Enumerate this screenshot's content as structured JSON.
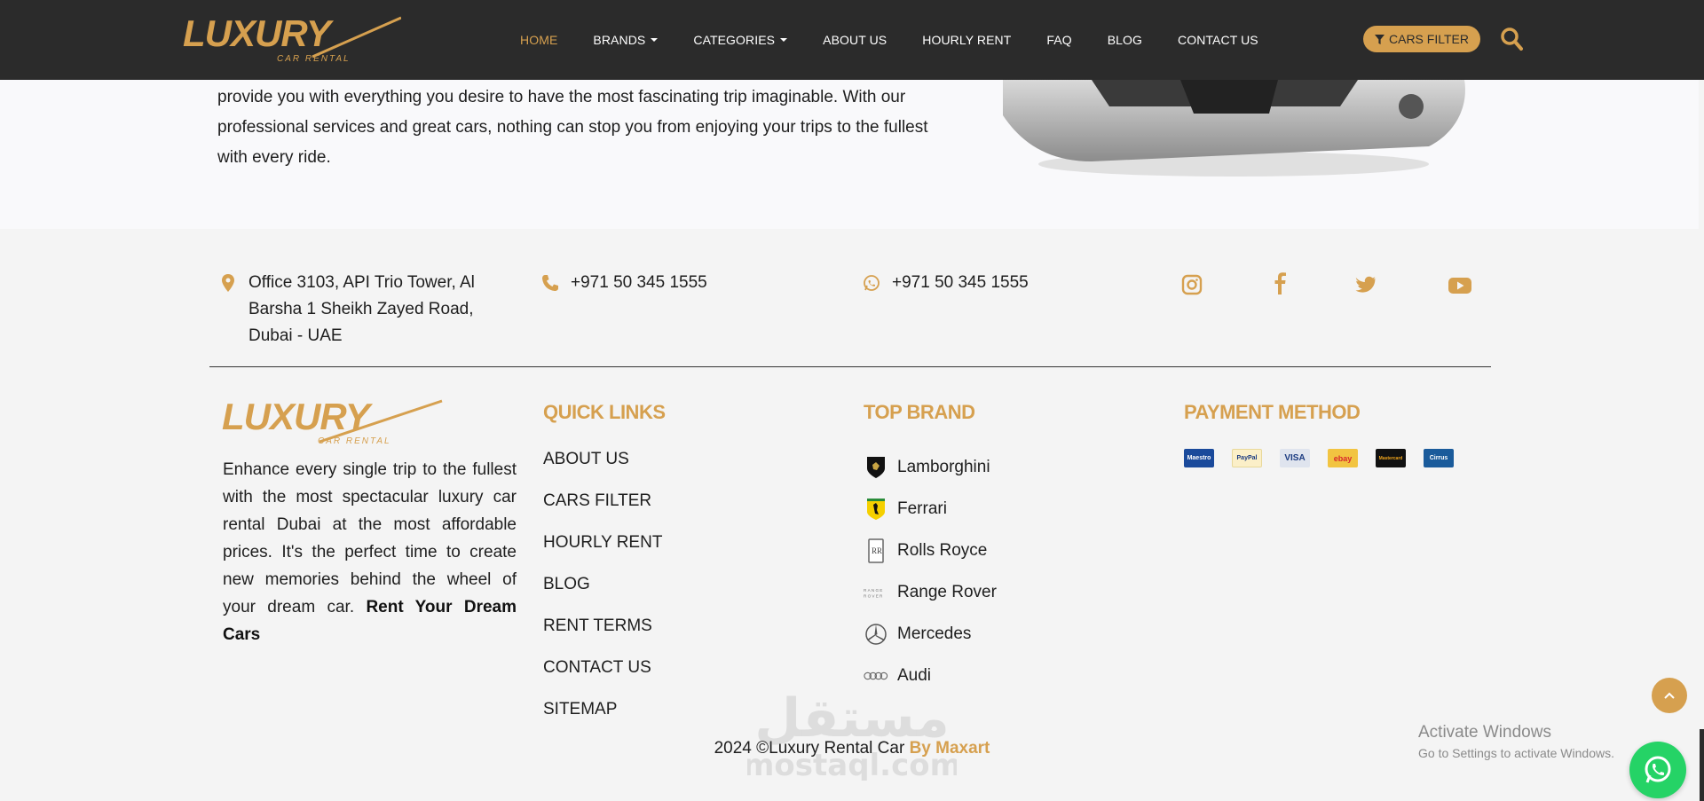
{
  "header": {
    "logo_text": "LUXURY",
    "logo_sub": "CAR RENTAL",
    "nav": [
      {
        "label": "HOME",
        "active": true,
        "dropdown": false
      },
      {
        "label": "BRANDS",
        "active": false,
        "dropdown": true
      },
      {
        "label": "CATEGORIES",
        "active": false,
        "dropdown": true
      },
      {
        "label": "ABOUT US",
        "active": false,
        "dropdown": false
      },
      {
        "label": "HOURLY RENT",
        "active": false,
        "dropdown": false
      },
      {
        "label": "FAQ",
        "active": false,
        "dropdown": false
      },
      {
        "label": "BLOG",
        "active": false,
        "dropdown": false
      },
      {
        "label": "CONTACT US",
        "active": false,
        "dropdown": false
      }
    ],
    "filter_button": "CARS FILTER",
    "search_icon": "search-icon"
  },
  "about": {
    "paragraph": "provide you with everything you desire to have the most fascinating trip imaginable. With our professional services and great cars, nothing can stop you from enjoying your trips to the fullest with every ride."
  },
  "contact": {
    "address": "Office 3103, API Trio Tower, Al Barsha 1 Sheikh Zayed Road, Dubai - UAE",
    "phone": "+971 50 345 1555",
    "whatsapp": "+971 50 345 1555",
    "social": [
      "instagram-icon",
      "facebook-icon",
      "twitter-icon",
      "youtube-icon"
    ]
  },
  "footer": {
    "description": "Enhance every single trip to the fullest with the most spectacular luxury car rental Dubai at the most affordable prices. It's the perfect time to create new memories behind the wheel of your dream car. ",
    "description_bold": "Rent Your Dream Cars",
    "quick_links_title": "QUICK LINKS",
    "quick_links": [
      "ABOUT US",
      "CARS FILTER",
      "HOURLY RENT",
      "BLOG",
      "RENT TERMS",
      "CONTACT US",
      "SITEMAP"
    ],
    "top_brand_title": "TOP BRAND",
    "brands": [
      "Lamborghini",
      "Ferrari",
      "Rolls Royce",
      "Range Rover",
      "Mercedes",
      "Audi"
    ],
    "payment_title": "PAYMENT METHOD",
    "payments": [
      "Maestro",
      "PayPal",
      "VISA",
      "ebay",
      "Mastercard",
      "Cirrus"
    ],
    "copyright": "2024 ©Luxury Rental Car ",
    "copyright_by": "By Maxart"
  },
  "overlay": {
    "watermark_ar": "مستقل",
    "watermark_en": "mostaql.com",
    "windows_title": "Activate Windows",
    "windows_sub": "Go to Settings to activate Windows."
  },
  "colors": {
    "accent": "#d6a04f",
    "header_bg": "#2b2b2b",
    "footer_bg": "#f4f4f4",
    "whatsapp": "#25d366"
  }
}
